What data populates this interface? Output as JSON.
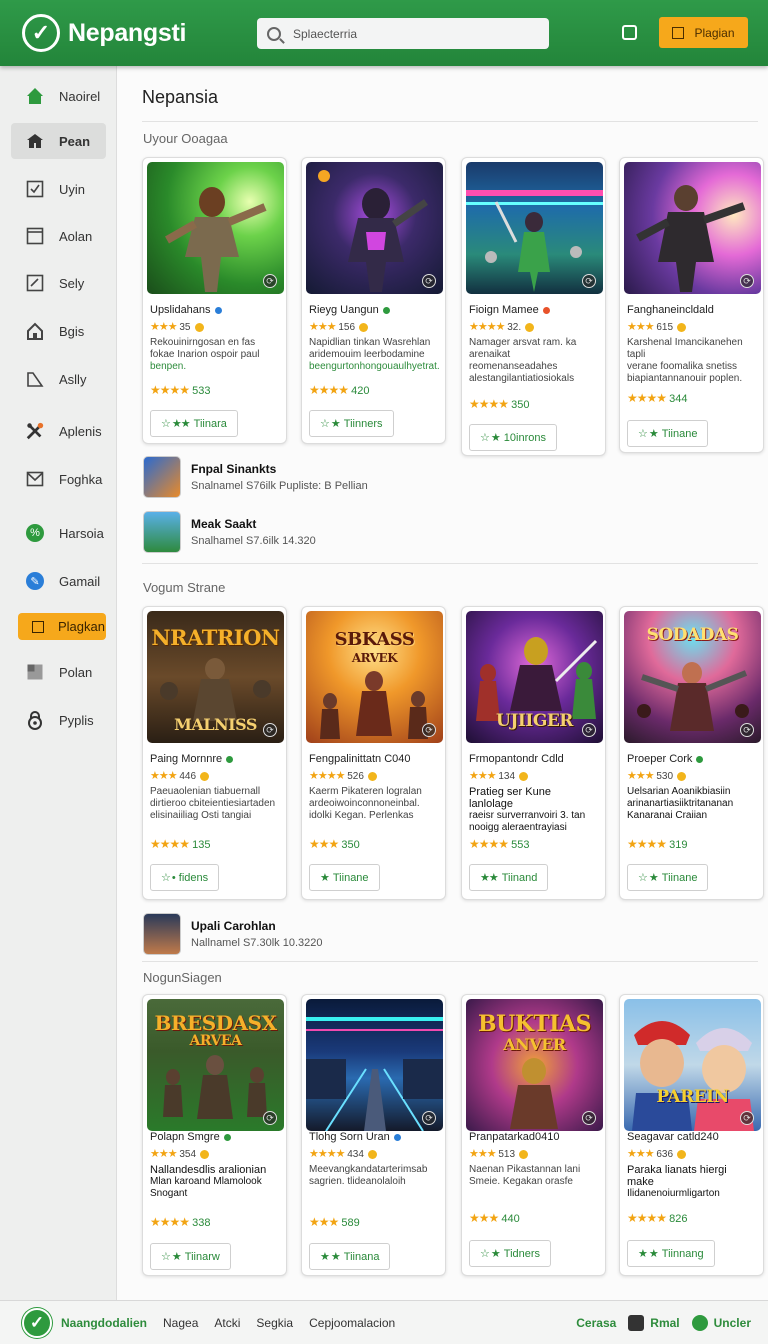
{
  "header": {
    "app_title": "Nepangsti",
    "logo_icon": "check-circle",
    "search_placeholder": "Splaecterria",
    "action_button": "Plagian"
  },
  "sidebar": {
    "items": [
      {
        "label": "Naoirel",
        "icon": "home-icon"
      },
      {
        "label": "Pean",
        "icon": "store-icon",
        "active": true
      },
      {
        "label": "Uyin",
        "icon": "check-box-icon"
      },
      {
        "label": "Aolan",
        "icon": "window-icon"
      },
      {
        "label": "Sely",
        "icon": "chart-icon"
      },
      {
        "label": "Bgis",
        "icon": "house-icon"
      },
      {
        "label": "Aslly",
        "icon": "arrow-icon"
      },
      {
        "label": "Aplenis",
        "icon": "tools-icon"
      },
      {
        "label": "Foghka",
        "icon": "mail-icon"
      },
      {
        "label": "Harsoia",
        "icon": "percent-icon"
      },
      {
        "label": "Gamail",
        "icon": "pencil-icon"
      },
      {
        "label": "Plagkan",
        "icon": "box-icon",
        "highlight": true
      },
      {
        "label": "Polan",
        "icon": "grid-icon"
      },
      {
        "label": "Pyplis",
        "icon": "lock-icon"
      }
    ]
  },
  "main": {
    "page_title": "Nepansia",
    "sections": [
      {
        "title": "Uyour Ooagaa",
        "cards": [
          {
            "title": "Upslidahans",
            "stars": "★★★",
            "count": "35",
            "desc1": "Rekouinirngosan en fas",
            "desc2": "fokae Inarion ospoir paul",
            "desc3": "benpen.",
            "score_stars": "★★★★",
            "score": "533",
            "button": "Tiinara"
          },
          {
            "title": "Rieyg Uangun",
            "stars": "★★★",
            "count": "156",
            "desc1": "Napidlian tinkan Wasrehlan",
            "desc2": "aridemouim leerbodamine",
            "desc3": "beengurtonhongouaulhyetrat.",
            "score_stars": "★★★★",
            "score": "420",
            "button": "Tiinners"
          },
          {
            "title": "Fioign Mamee",
            "stars": "★★★★",
            "count": "32.",
            "desc1": "Namager arsvat ram. ka",
            "desc2": "arenaikat reomenanseadahes",
            "desc3": "alestangilantiatiosiokals",
            "score_stars": "★★★★",
            "score": "350",
            "button": "10inrons"
          },
          {
            "title": "Fanghaneincldald",
            "stars": "★★★",
            "count": "615",
            "desc1": "Karshenal Imancikanehen tapli",
            "desc2": "verane foomalika snetiss",
            "desc3": "biapiantannanouir poplen.",
            "score_stars": "★★★★",
            "score": "344",
            "button": "Tiinane"
          }
        ]
      },
      {
        "title": "Vogum Strane",
        "cards": [
          {
            "title": "Paing Mornnre",
            "stars": "★★★",
            "count": "446",
            "desc1": "Paeuaolenian tiabuernall",
            "desc2": "dirtieroo cbiteientiesiartaden",
            "desc3": "elisinaiiliag Osti tangiai",
            "score_stars": "★★★★",
            "score": "135",
            "button": "fidens"
          },
          {
            "title": "Fengpalinittatn C040",
            "stars": "★★★★",
            "count": "526",
            "desc1": "Kaerm Pikateren logralan",
            "desc2": "ardeoiwoinconnoneinbal.",
            "desc3": "idolki Kegan. Perlenkas",
            "score_stars": "★★★",
            "score": "350",
            "button": "Tiinane"
          },
          {
            "title": "Frmopantondr Cdld",
            "stars": "★★★",
            "count": "134",
            "desc1": "Pratieg ser Kune lanlolage",
            "desc2": "raeisr surverranvoiri 3. tan",
            "desc3": "nooigg aleraentrayiasi",
            "score_stars": "★★★★",
            "score": "553",
            "button": "Tiinand"
          },
          {
            "title": "Proeper Cork",
            "stars": "★★★",
            "count": "530",
            "desc1": "Uelsarian Aoanikbiasiin",
            "desc2": "arinanartiasiiktritananan",
            "desc3": "Kanaranai Craiian",
            "score_stars": "★★★★",
            "score": "319",
            "button": "Tiinane"
          }
        ]
      },
      {
        "title": "NogunSiagen",
        "cards": [
          {
            "title": "Polapn Smgre",
            "stars": "★★★",
            "count": "354",
            "desc1": "Nallandesdlis aralionian",
            "desc2": "Mlan karoand Mlamolook",
            "desc3": "Snogant",
            "score_stars": "★★★★",
            "score": "338",
            "button": "Tiinarw"
          },
          {
            "title": "Tlohg Sorn Uran",
            "stars": "★★★★",
            "count": "434",
            "desc1": "Meevangkandatarterimsab",
            "desc2": "sagrien. tlideanolaloih",
            "desc3": "",
            "score_stars": "★★★",
            "score": "589",
            "button": "Tiinana"
          },
          {
            "title": "Pranpatarkad0410",
            "stars": "★★★",
            "count": "513",
            "desc1": "Naenan Pikastannan lani",
            "desc2": "Smeie. Kegakan orasfe",
            "desc3": "",
            "score_stars": "★★★",
            "score": "440",
            "button": "Tidners"
          },
          {
            "title": "Seagavar catld240",
            "stars": "★★★",
            "count": "636",
            "desc1": "Paraka lianats hiergi make",
            "desc2": "Ilidanenoiurmligarton",
            "desc3": "",
            "score_stars": "★★★★",
            "score": "826",
            "button": "Tiinnang"
          }
        ]
      }
    ],
    "list_items": [
      {
        "title": "Fnpal Sinankts",
        "sub": "Snalnamel S76ilk Pupliste: B Pellian"
      },
      {
        "title": "Meak Saakt",
        "sub": "Snalhamel S7.6ilk 14.320"
      },
      {
        "title": "Upali Carohlan",
        "sub": "Nallnamel S7.30lk 10.3220"
      }
    ]
  },
  "footer": {
    "brand": "Naangdodalien",
    "links": [
      "Nagea",
      "Atcki",
      "Segkia",
      "Cepjoomalacion"
    ],
    "right_text": "Cerasa",
    "right_item1": "Rmal",
    "right_item2": "Uncler"
  },
  "colors": {
    "brand_green": "#2e9a3e",
    "accent_orange": "#f6a81b",
    "star_gold": "#f2a413"
  }
}
